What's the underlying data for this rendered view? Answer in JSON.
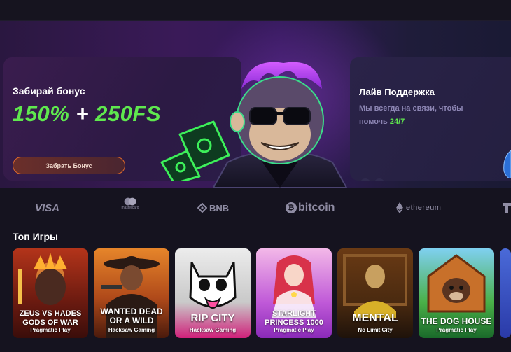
{
  "hero": {
    "bonus": {
      "title": "Забирай бонус",
      "amount_percent": "150%",
      "amount_plus": "+",
      "amount_fs": "250FS",
      "button_label": "Забрать Бонус"
    },
    "support": {
      "title": "Лайв Поддержка",
      "text_prefix": "Мы всегда на связи, чтобы помочь",
      "text_highlight": "24/7"
    },
    "nav": {
      "prev": "‹",
      "next": "›"
    }
  },
  "payments": [
    {
      "name": "VISA"
    },
    {
      "name": "mastercard"
    },
    {
      "name": "BNB"
    },
    {
      "name": "bitcoin"
    },
    {
      "name": "ethereum"
    }
  ],
  "top_games": {
    "title": "Топ Игры",
    "games": [
      {
        "title_line1": "ZEUS VS HADES",
        "title_line2": "GODS OF WAR",
        "provider": "Pragmatic Play"
      },
      {
        "title_line1": "WANTED DEAD",
        "title_line2": "OR A WILD",
        "provider": "Hacksaw Gaming"
      },
      {
        "title_line1": "RIP CITY",
        "title_line2": "",
        "provider": "Hacksaw Gaming"
      },
      {
        "title_line1": "STARLIGHT",
        "title_line2": "PRINCESS 1000",
        "provider": "Pragmatic Play"
      },
      {
        "title_line1": "MENTAL",
        "title_line2": "",
        "provider": "No Limit City"
      },
      {
        "title_line1": "THE DOG HOUSE",
        "title_line2": "",
        "provider": "Pragmatic Play"
      }
    ]
  },
  "colors": {
    "background": "#15131f",
    "accent_green": "#5fe84e",
    "accent_orange": "#e06a2c",
    "muted_text": "#8d86b4"
  }
}
